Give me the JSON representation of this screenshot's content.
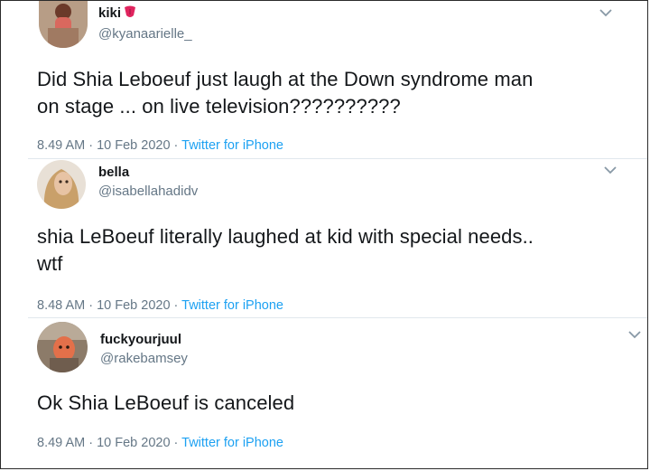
{
  "tweets": [
    {
      "name": "kiki",
      "name_emoji": "tongue-emoji",
      "handle": "@kyanaarielle_",
      "text_lines": [
        "Did Shia Leboeuf just laugh at the Down syndrome man",
        "on stage ... on live television??????????"
      ],
      "time": "8.49 AM",
      "date": "10 Feb 2020",
      "source": "Twitter for iPhone",
      "menu_icon": "chevron-down-icon"
    },
    {
      "name": "bella",
      "handle": "@isabellahadidv",
      "text_lines": [
        "shia LeBoeuf literally laughed at kid with special needs..",
        "wtf"
      ],
      "time": "8.48 AM",
      "date": "10 Feb 2020",
      "source": "Twitter for iPhone",
      "menu_icon": "chevron-down-icon"
    },
    {
      "name": "fuckyourjuul",
      "handle": "@rakebamsey",
      "text_lines": [
        "Ok Shia LeBoeuf is canceled"
      ],
      "time": "8.49 AM",
      "date": "10 Feb 2020",
      "source": "Twitter for iPhone",
      "menu_icon": "chevron-down-icon"
    }
  ],
  "colors": {
    "text": "#14171a",
    "secondary": "#657786",
    "link": "#1da1f2",
    "divider": "#e1e8ed"
  }
}
